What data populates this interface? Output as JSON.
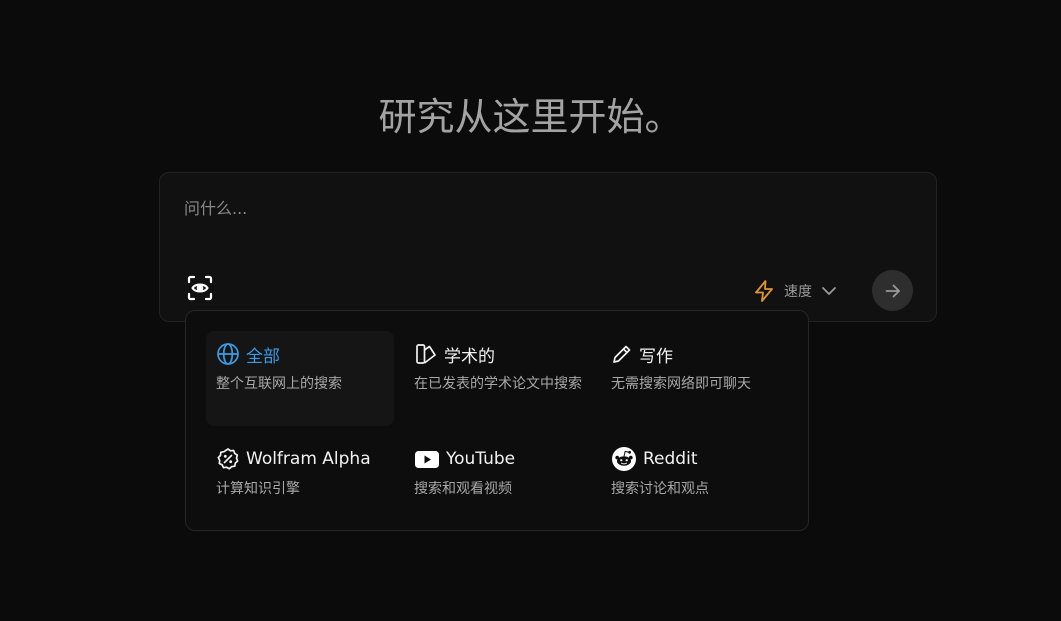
{
  "headline": "研究从这里开始。",
  "search": {
    "placeholder": "问什么...",
    "value": "",
    "mode_label": "速度",
    "accent_color": "#e0962f"
  },
  "focus_panel": {
    "options": [
      {
        "title": "全部",
        "desc": "整个互联网上的搜索",
        "icon": "globe-icon",
        "active": true
      },
      {
        "title": "学术的",
        "desc": "在已发表的学术论文中搜索",
        "icon": "academic-icon",
        "active": false
      },
      {
        "title": "写作",
        "desc": "无需搜索网络即可聊天",
        "icon": "pencil-icon",
        "active": false
      },
      {
        "title": "Wolfram Alpha",
        "desc": "计算知识引擎",
        "icon": "wolfram-icon",
        "active": false
      },
      {
        "title": "YouTube",
        "desc": "搜索和观看视频",
        "icon": "youtube-icon",
        "active": false
      },
      {
        "title": "Reddit",
        "desc": "搜索讨论和观点",
        "icon": "reddit-icon",
        "active": false
      }
    ]
  },
  "colors": {
    "background": "#0b0b0b",
    "active_focus": "#3b9be6"
  }
}
